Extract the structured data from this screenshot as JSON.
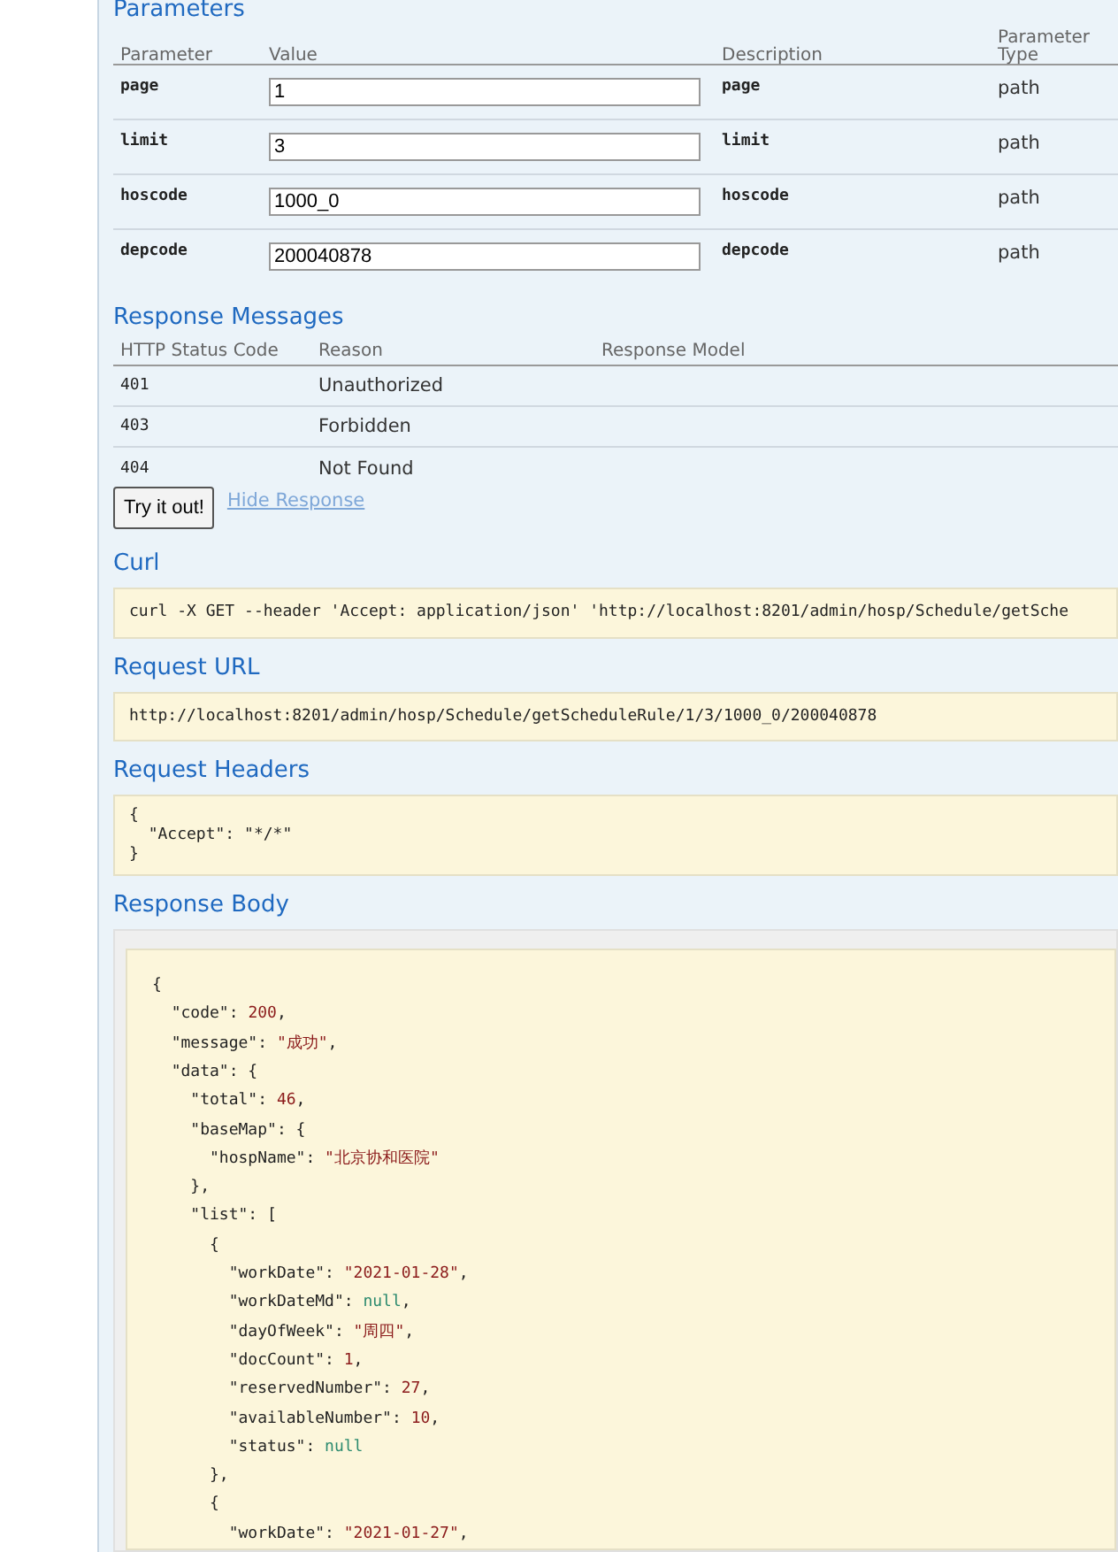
{
  "parameters": {
    "title": "Parameters",
    "columns": [
      "Parameter",
      "Value",
      "Description",
      "Parameter\nType"
    ],
    "rows": [
      {
        "name": "page",
        "value": "1",
        "description": "page",
        "type": "path"
      },
      {
        "name": "limit",
        "value": "3",
        "description": "limit",
        "type": "path"
      },
      {
        "name": "hoscode",
        "value": "1000_0",
        "description": "hoscode",
        "type": "path"
      },
      {
        "name": "depcode",
        "value": "200040878",
        "description": "depcode",
        "type": "path"
      }
    ]
  },
  "response_messages": {
    "title": "Response Messages",
    "columns": [
      "HTTP Status Code",
      "Reason",
      "Response Model"
    ],
    "rows": [
      {
        "code": "401",
        "reason": "Unauthorized"
      },
      {
        "code": "403",
        "reason": "Forbidden"
      },
      {
        "code": "404",
        "reason": "Not Found"
      }
    ]
  },
  "try_button": "Try it out!",
  "hide_link": "Hide Response",
  "curl": {
    "title": "Curl",
    "text": "curl -X GET --header 'Accept: application/json' 'http://localhost:8201/admin/hosp/Schedule/getSche"
  },
  "request_url": {
    "title": "Request URL",
    "text": "http://localhost:8201/admin/hosp/Schedule/getScheduleRule/1/3/1000_0/200040878"
  },
  "request_headers": {
    "title": "Request Headers",
    "lines": [
      "{",
      "  \"Accept\": \"*/*\"",
      "}"
    ]
  },
  "response_body": {
    "title": "Response Body",
    "lines": [
      [
        {
          "kind": "plain",
          "text": "{"
        }
      ],
      [
        {
          "kind": "plain",
          "text": "  \"code\": "
        },
        {
          "kind": "number",
          "text": "200"
        },
        {
          "kind": "plain",
          "text": ","
        }
      ],
      [
        {
          "kind": "plain",
          "text": "  \"message\": "
        },
        {
          "kind": "string",
          "text": "\"成功\""
        },
        {
          "kind": "plain",
          "text": ","
        }
      ],
      [
        {
          "kind": "plain",
          "text": "  \"data\": {"
        }
      ],
      [
        {
          "kind": "plain",
          "text": "    \"total\": "
        },
        {
          "kind": "number",
          "text": "46"
        },
        {
          "kind": "plain",
          "text": ","
        }
      ],
      [
        {
          "kind": "plain",
          "text": "    \"baseMap\": {"
        }
      ],
      [
        {
          "kind": "plain",
          "text": "      \"hospName\": "
        },
        {
          "kind": "string",
          "text": "\"北京协和医院\""
        }
      ],
      [
        {
          "kind": "plain",
          "text": "    },"
        }
      ],
      [
        {
          "kind": "plain",
          "text": "    \"list\": ["
        }
      ],
      [
        {
          "kind": "plain",
          "text": "      {"
        }
      ],
      [
        {
          "kind": "plain",
          "text": "        \"workDate\": "
        },
        {
          "kind": "string",
          "text": "\"2021-01-28\""
        },
        {
          "kind": "plain",
          "text": ","
        }
      ],
      [
        {
          "kind": "plain",
          "text": "        \"workDateMd\": "
        },
        {
          "kind": "null",
          "text": "null"
        },
        {
          "kind": "plain",
          "text": ","
        }
      ],
      [
        {
          "kind": "plain",
          "text": "        \"dayOfWeek\": "
        },
        {
          "kind": "string",
          "text": "\"周四\""
        },
        {
          "kind": "plain",
          "text": ","
        }
      ],
      [
        {
          "kind": "plain",
          "text": "        \"docCount\": "
        },
        {
          "kind": "number",
          "text": "1"
        },
        {
          "kind": "plain",
          "text": ","
        }
      ],
      [
        {
          "kind": "plain",
          "text": "        \"reservedNumber\": "
        },
        {
          "kind": "number",
          "text": "27"
        },
        {
          "kind": "plain",
          "text": ","
        }
      ],
      [
        {
          "kind": "plain",
          "text": "        \"availableNumber\": "
        },
        {
          "kind": "number",
          "text": "10"
        },
        {
          "kind": "plain",
          "text": ","
        }
      ],
      [
        {
          "kind": "plain",
          "text": "        \"status\": "
        },
        {
          "kind": "null",
          "text": "null"
        }
      ],
      [
        {
          "kind": "plain",
          "text": "      },"
        }
      ],
      [
        {
          "kind": "plain",
          "text": "      {"
        }
      ],
      [
        {
          "kind": "plain",
          "text": "        \"workDate\": "
        },
        {
          "kind": "string",
          "text": "\"2021-01-27\""
        },
        {
          "kind": "plain",
          "text": ","
        }
      ]
    ]
  }
}
